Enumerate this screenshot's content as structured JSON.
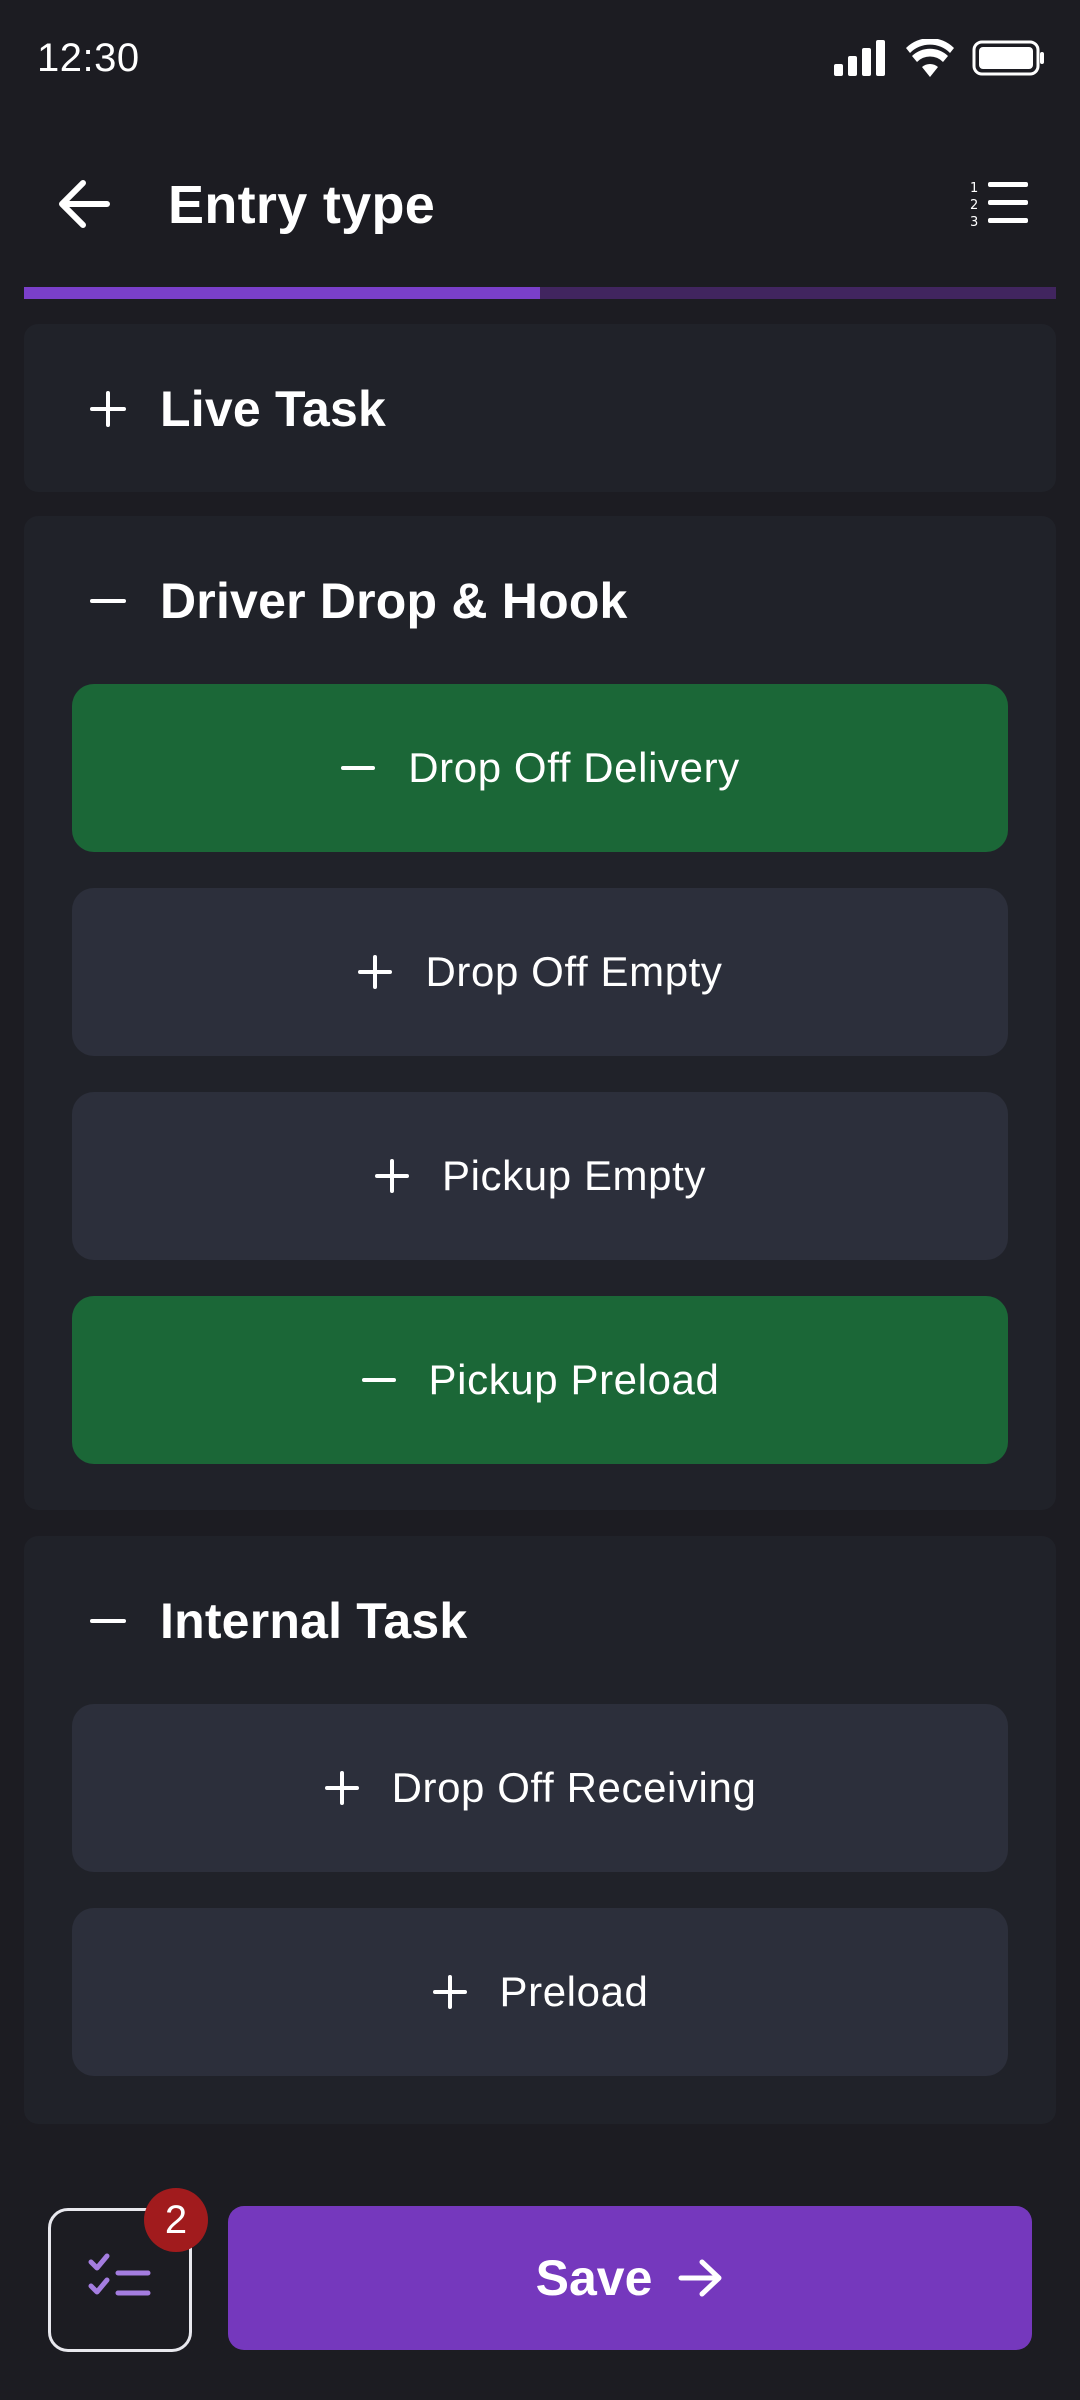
{
  "status_bar": {
    "time": "12:30",
    "icons": [
      "signal-icon",
      "wifi-icon",
      "battery-icon"
    ]
  },
  "app_bar": {
    "title": "Entry type",
    "back_icon": "arrow-left-icon",
    "menu_icon": "numbered-list-icon"
  },
  "progress": {
    "fraction": 0.5,
    "fill_color": "#7a3fca",
    "track_color": "#41255f"
  },
  "sections": [
    {
      "title": "Live Task",
      "expanded": false,
      "options": []
    },
    {
      "title": "Driver Drop & Hook",
      "expanded": true,
      "options": [
        {
          "label": "Drop Off Delivery",
          "selected": true
        },
        {
          "label": "Drop Off Empty",
          "selected": false
        },
        {
          "label": "Pickup Empty",
          "selected": false
        },
        {
          "label": "Pickup Preload",
          "selected": true
        }
      ]
    },
    {
      "title": "Internal Task",
      "expanded": true,
      "options": [
        {
          "label": "Drop Off Receiving",
          "selected": false
        },
        {
          "label": "Preload",
          "selected": false
        }
      ]
    }
  ],
  "bottom_bar": {
    "badge_count": "2",
    "save_label": "Save",
    "checklist_icon": "checklist-icon",
    "save_icon": "arrow-right-icon"
  },
  "colors": {
    "background": "#1c1c22",
    "selected": "#1b6737",
    "unselected": "#2c2f3b",
    "accent": "#7538bd",
    "badge": "#a11b1d"
  }
}
